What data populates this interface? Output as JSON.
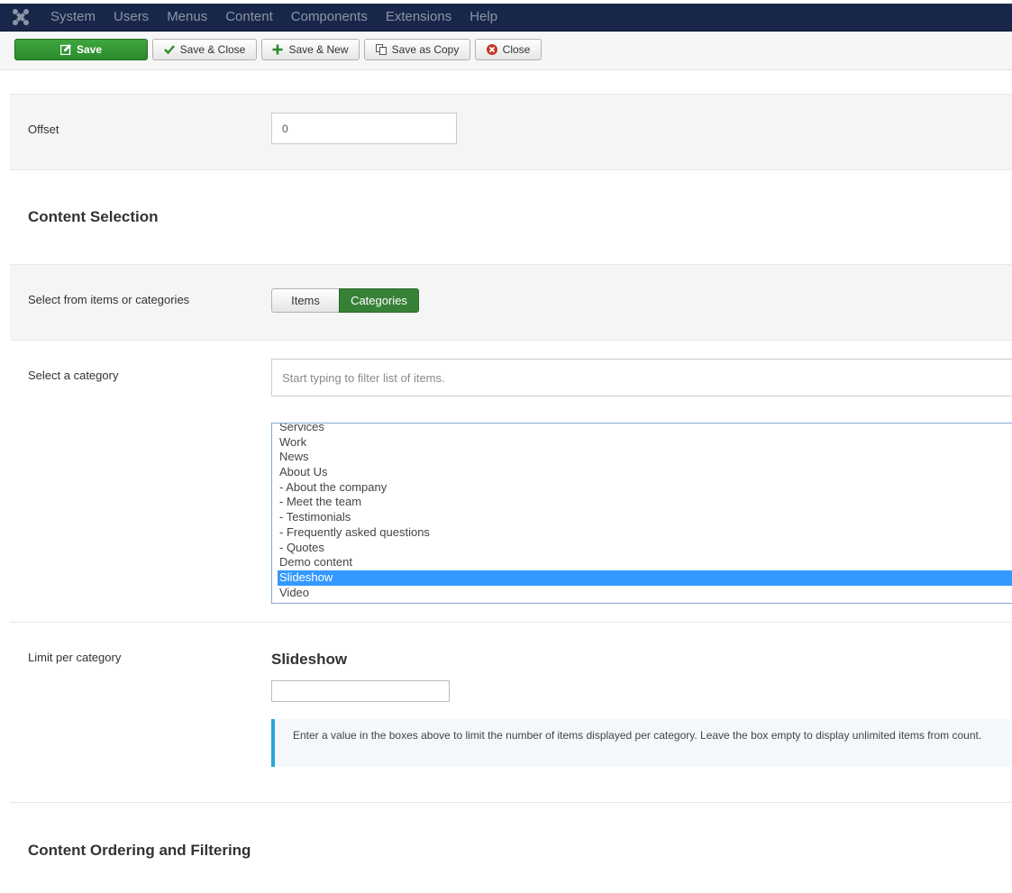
{
  "nav": {
    "items": [
      "System",
      "Users",
      "Menus",
      "Content",
      "Components",
      "Extensions",
      "Help"
    ]
  },
  "toolbar": {
    "save": "Save",
    "save_close": "Save & Close",
    "save_new": "Save & New",
    "save_copy": "Save as Copy",
    "close": "Close"
  },
  "form": {
    "offset": {
      "label": "Offset",
      "value": "0"
    },
    "content_selection": {
      "title": "Content Selection"
    },
    "select_from": {
      "label": "Select from items or categories",
      "options": [
        "Items",
        "Categories"
      ],
      "active": "Categories"
    },
    "select_category": {
      "label": "Select a category",
      "placeholder": "Start typing to filter list of items.",
      "options": [
        "Services",
        "Work",
        "News",
        "About Us",
        "- About the company",
        "- Meet the team",
        "- Testimonials",
        "- Frequently asked questions",
        "- Quotes",
        "Demo content",
        "Slideshow",
        "Video"
      ],
      "selected": "Slideshow"
    },
    "limit": {
      "label": "Limit per category",
      "category_title": "Slideshow",
      "value": "",
      "help": "Enter a value in the boxes above to limit the number of items displayed per category. Leave the box empty to display unlimited items from count."
    },
    "ordering": {
      "title": "Content Ordering and Filtering"
    }
  },
  "colors": {
    "navbar": "#182749",
    "save_green": "#2f962f",
    "active_green": "#378137",
    "selected_blue": "#3399ff",
    "info_border": "#2aa6d8"
  }
}
